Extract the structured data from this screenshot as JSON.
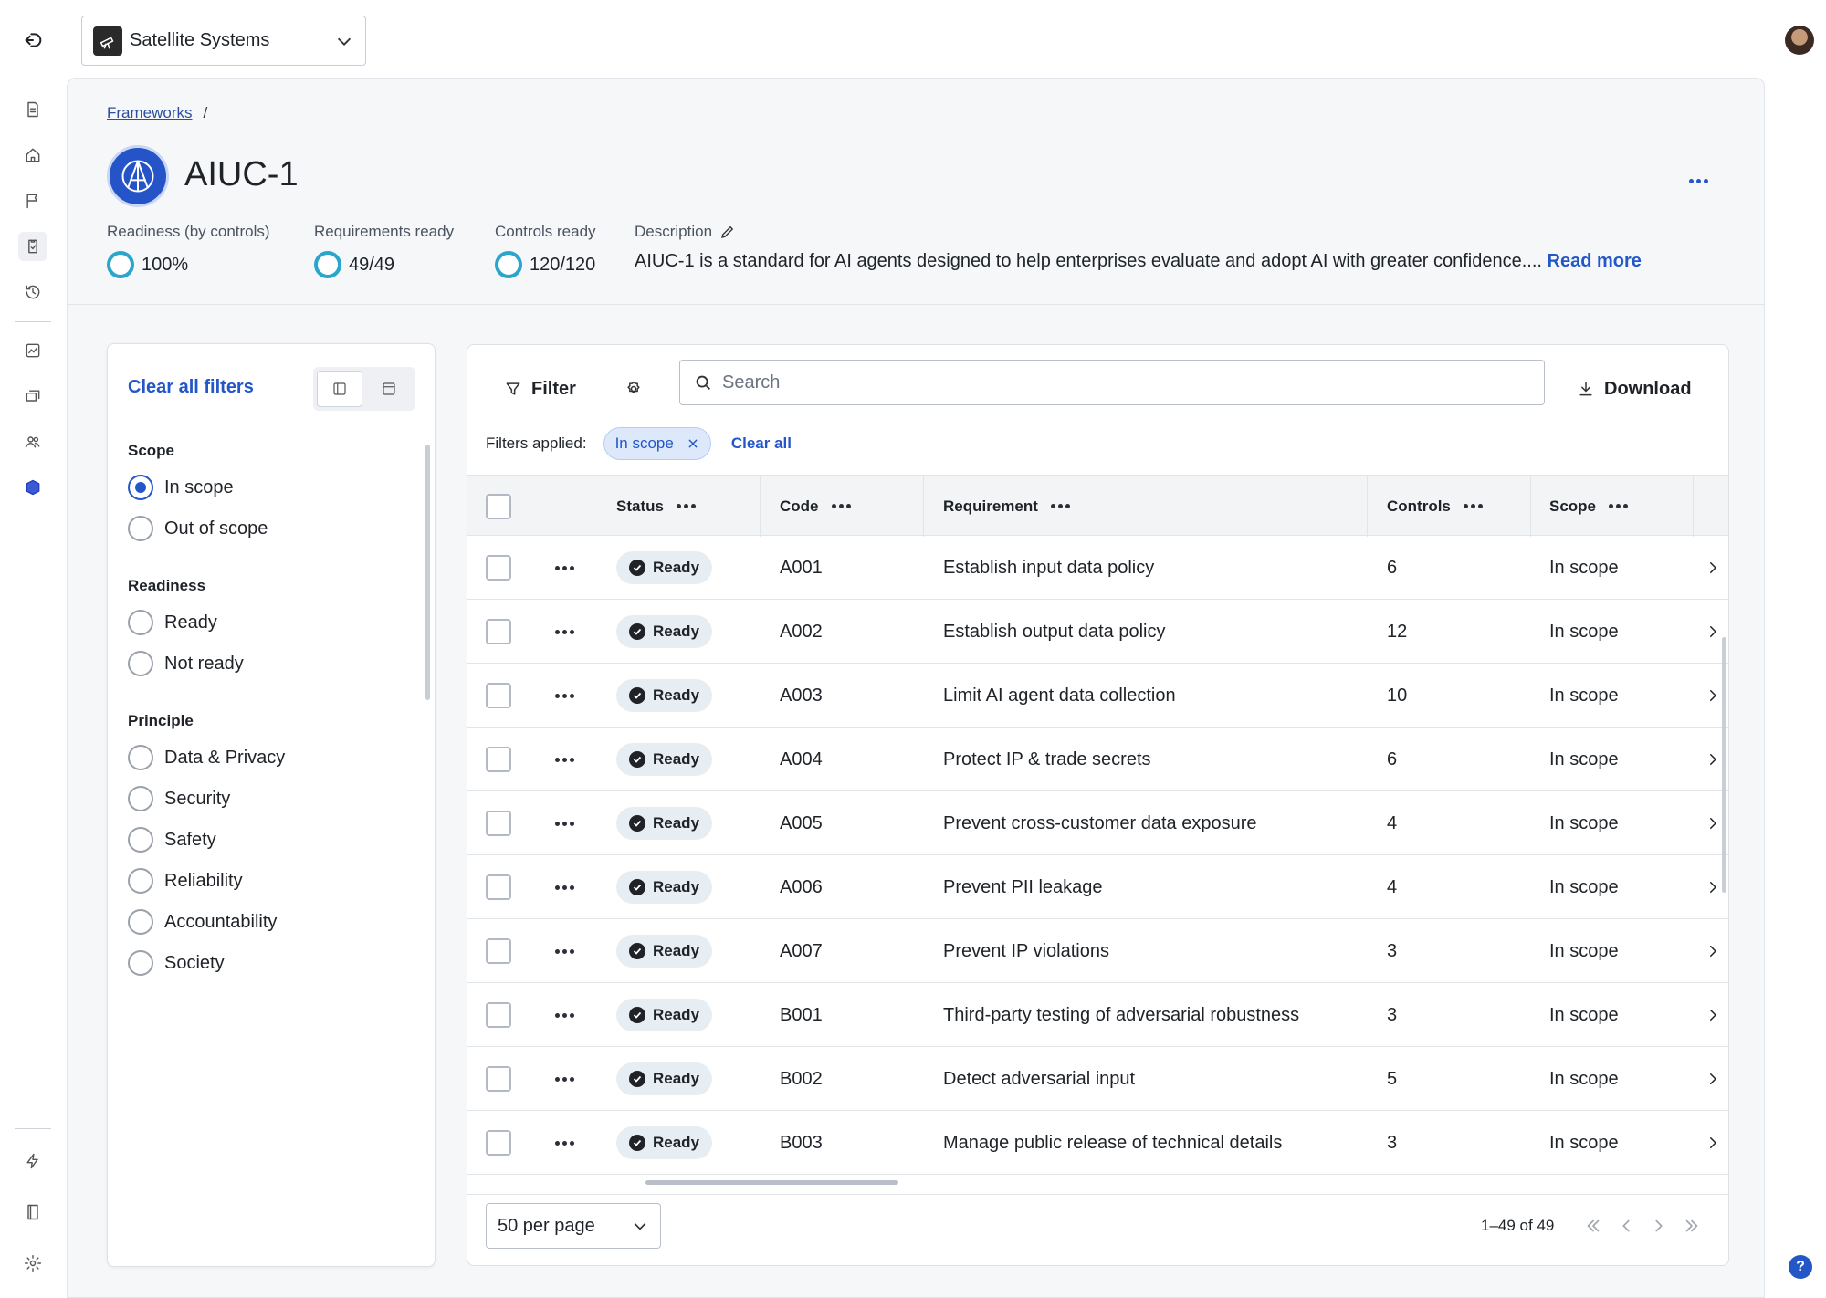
{
  "org": {
    "name": "Satellite Systems",
    "logo_icon": "telescope-icon"
  },
  "breadcrumb": {
    "parent": "Frameworks",
    "separator": "/"
  },
  "framework": {
    "title": "AIUC-1",
    "stats": {
      "readiness_label": "Readiness (by controls)",
      "readiness_value": "100%",
      "requirements_label": "Requirements ready",
      "requirements_value": "49/49",
      "controls_label": "Controls ready",
      "controls_value": "120/120"
    },
    "description_label": "Description",
    "description_text": "AIUC-1 is a standard for AI agents designed to help enterprises evaluate and adopt AI with greater confidence....",
    "read_more": "Read more"
  },
  "filters": {
    "clear_all": "Clear all filters",
    "groups": [
      {
        "title": "Scope",
        "options": [
          {
            "label": "In scope",
            "checked": true
          },
          {
            "label": "Out of scope",
            "checked": false
          }
        ]
      },
      {
        "title": "Readiness",
        "options": [
          {
            "label": "Ready",
            "checked": false
          },
          {
            "label": "Not ready",
            "checked": false
          }
        ]
      },
      {
        "title": "Principle",
        "options": [
          {
            "label": "Data & Privacy",
            "checked": false
          },
          {
            "label": "Security",
            "checked": false
          },
          {
            "label": "Safety",
            "checked": false
          },
          {
            "label": "Reliability",
            "checked": false
          },
          {
            "label": "Accountability",
            "checked": false
          },
          {
            "label": "Society",
            "checked": false
          }
        ]
      }
    ]
  },
  "toolbar": {
    "filter_label": "Filter",
    "search_placeholder": "Search",
    "download_label": "Download"
  },
  "applied": {
    "label": "Filters applied:",
    "chip": "In scope",
    "clear_all": "Clear all"
  },
  "table": {
    "columns": {
      "status": "Status",
      "code": "Code",
      "requirement": "Requirement",
      "controls": "Controls",
      "scope": "Scope"
    },
    "rows": [
      {
        "status": "Ready",
        "code": "A001",
        "requirement": "Establish input data policy",
        "controls": "6",
        "scope": "In scope"
      },
      {
        "status": "Ready",
        "code": "A002",
        "requirement": "Establish output data policy",
        "controls": "12",
        "scope": "In scope"
      },
      {
        "status": "Ready",
        "code": "A003",
        "requirement": "Limit AI agent data collection",
        "controls": "10",
        "scope": "In scope"
      },
      {
        "status": "Ready",
        "code": "A004",
        "requirement": "Protect IP & trade secrets",
        "controls": "6",
        "scope": "In scope"
      },
      {
        "status": "Ready",
        "code": "A005",
        "requirement": "Prevent cross-customer data exposure",
        "controls": "4",
        "scope": "In scope"
      },
      {
        "status": "Ready",
        "code": "A006",
        "requirement": "Prevent PII leakage",
        "controls": "4",
        "scope": "In scope"
      },
      {
        "status": "Ready",
        "code": "A007",
        "requirement": "Prevent IP violations",
        "controls": "3",
        "scope": "In scope"
      },
      {
        "status": "Ready",
        "code": "B001",
        "requirement": "Third-party testing of adversarial robustness",
        "controls": "3",
        "scope": "In scope"
      },
      {
        "status": "Ready",
        "code": "B002",
        "requirement": "Detect adversarial input",
        "controls": "5",
        "scope": "In scope"
      },
      {
        "status": "Ready",
        "code": "B003",
        "requirement": "Manage public release of technical details",
        "controls": "3",
        "scope": "In scope"
      }
    ]
  },
  "pagination": {
    "per_page": "50 per page",
    "range": "1–49 of 49"
  },
  "help": {
    "label": "?"
  }
}
